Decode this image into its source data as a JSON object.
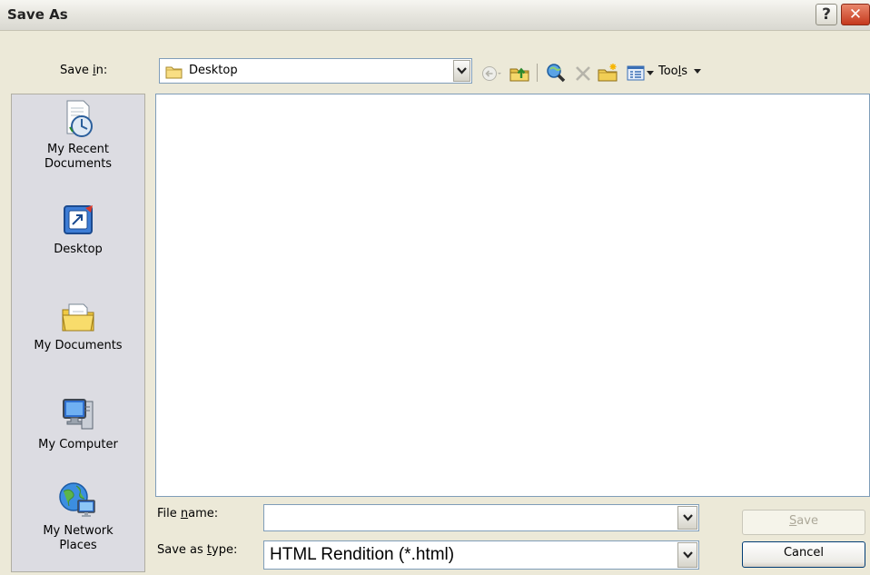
{
  "window": {
    "title": "Save As"
  },
  "titlebar": {
    "help_symbol": "?",
    "close_symbol": "✕"
  },
  "save_in": {
    "label_pre": "Save ",
    "label_access": "i",
    "label_post": "n:",
    "value": "Desktop"
  },
  "toolbar": {
    "tools_pre": "Too",
    "tools_access": "l",
    "tools_post": "s",
    "icons": [
      "back-icon",
      "up-folder-icon",
      "search-web-icon",
      "delete-icon",
      "new-folder-icon",
      "views-icon"
    ]
  },
  "places": [
    {
      "line1": "My Recent",
      "line2": "Documents",
      "icon": "recent-documents-icon"
    },
    {
      "line1": "Desktop",
      "line2": "",
      "icon": "desktop-icon"
    },
    {
      "line1": "My Documents",
      "line2": "",
      "icon": "my-documents-icon"
    },
    {
      "line1": "My Computer",
      "line2": "",
      "icon": "my-computer-icon"
    },
    {
      "line1": "My Network",
      "line2": "Places",
      "icon": "network-places-icon"
    }
  ],
  "file_name": {
    "label_pre": "File ",
    "label_access": "n",
    "label_post": "ame:",
    "value": ""
  },
  "save_as_type": {
    "label_pre": "Save as ",
    "label_access": "t",
    "label_post": "ype:",
    "value": "HTML Rendition (*.html)"
  },
  "buttons": {
    "save_access": "S",
    "save_rest": "ave",
    "cancel": "Cancel"
  },
  "colors": {
    "dialog_bg": "#ece9d8",
    "places_bg": "#dcdce2",
    "field_border": "#7f9db9",
    "button_border": "#003c74",
    "close_red": "#c5391e"
  }
}
